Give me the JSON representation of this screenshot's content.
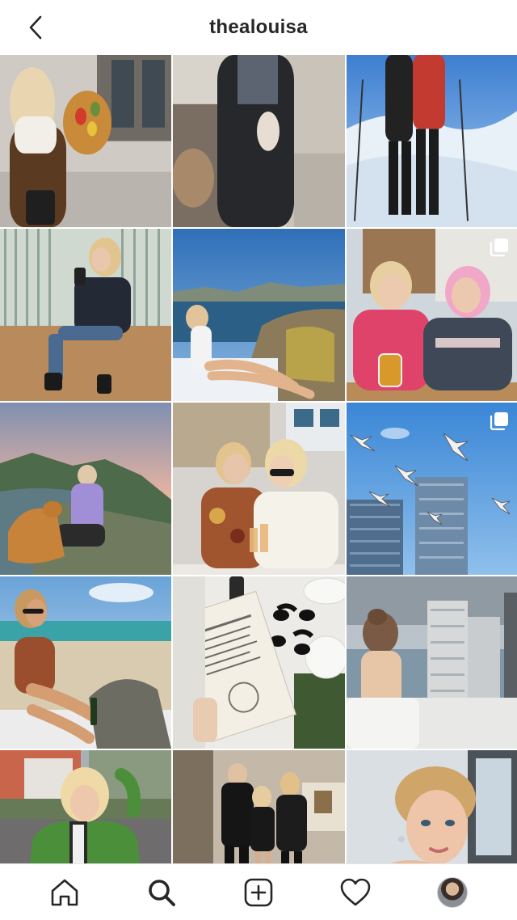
{
  "header": {
    "title": "thealouisa",
    "back_icon": "chevron-left-icon"
  },
  "posts": [
    {
      "id": "post-1",
      "scene": "woman-with-flower-bouquet",
      "multi": false
    },
    {
      "id": "post-2",
      "scene": "woman-in-coat-outdoor-cafe",
      "multi": false
    },
    {
      "id": "post-3",
      "scene": "skiers-in-snow",
      "multi": false
    },
    {
      "id": "post-4",
      "scene": "woman-in-mirror-room",
      "multi": false
    },
    {
      "id": "post-5",
      "scene": "woman-in-swimsuit-on-rocks",
      "multi": false
    },
    {
      "id": "post-6",
      "scene": "two-women-laughing-with-beer",
      "multi": true
    },
    {
      "id": "post-7",
      "scene": "woman-with-dog-at-coast",
      "multi": false
    },
    {
      "id": "post-8",
      "scene": "two-women-with-wine",
      "multi": false
    },
    {
      "id": "post-9",
      "scene": "seagulls-and-skyscrapers",
      "multi": true
    },
    {
      "id": "post-10",
      "scene": "woman-on-beach",
      "multi": false
    },
    {
      "id": "post-11",
      "scene": "restaurant-menu-table",
      "multi": false
    },
    {
      "id": "post-12",
      "scene": "woman-on-balcony-towers",
      "multi": false
    },
    {
      "id": "post-13",
      "scene": "woman-in-green-jacket",
      "multi": false
    },
    {
      "id": "post-14",
      "scene": "group-in-black-outfits",
      "multi": false
    },
    {
      "id": "post-15",
      "scene": "woman-selfie-portrait",
      "multi": false
    }
  ],
  "tabbar": {
    "items": [
      "home-icon",
      "search-icon",
      "new-post-icon",
      "heart-icon",
      "profile-avatar"
    ]
  }
}
